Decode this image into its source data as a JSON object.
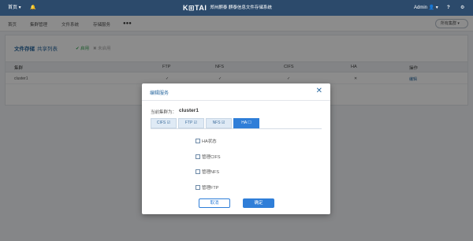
{
  "topbar": {
    "home": "首页 ▾",
    "bell": "🔔",
    "brand_logo": "K⊞TAI",
    "brand_name": "郑州麒泰  麒泰信息文件存储系统",
    "user": "Admin 👤 ▾",
    "help": "?",
    "settings": "⚙"
  },
  "nav": {
    "items": [
      "首页",
      "集群管理",
      "文件系统",
      "存储服务",
      "●●●"
    ],
    "cluster_select": "所有集群 ▾"
  },
  "card": {
    "title": "文件存储",
    "sub": "共享列表",
    "enable": "✔ 启用",
    "disable": "✖ 未启用",
    "columns": [
      "集群",
      "FTP",
      "NFS",
      "CIFS",
      "HA",
      "操作"
    ],
    "row": [
      "cluster1",
      "✓",
      "✓",
      "✓",
      "✕",
      "编辑"
    ]
  },
  "modal": {
    "title": "编辑服务",
    "close": "✕",
    "current_label": "当前集群为：",
    "current_value": "cluster1",
    "tabs": [
      "CIFS ☑",
      "FTP ☑",
      "NFS ☑",
      "HA ☐"
    ],
    "active_tab": 3,
    "options": [
      "HA状态",
      "管理CIFS",
      "管理NFS",
      "管理FTP"
    ],
    "cancel": "取消",
    "ok": "确定"
  },
  "colors": {
    "topbar": "#2c4a6b",
    "accent": "#2f7ed8",
    "enabled": "#3aa857"
  }
}
